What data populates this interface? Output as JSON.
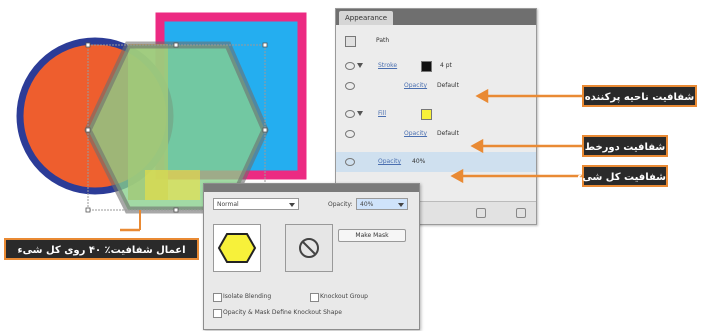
{
  "colors": {
    "accent_orange": "#e98a34",
    "callout_bg": "#2a2a2a",
    "circle_fill": "#ee5e2e",
    "circle_stroke": "#2c3c97",
    "rect_fill": "#24aef0",
    "rect_stroke": "#ec2a82",
    "hexagon_fill": "#88cf8c",
    "hexagon_stroke": "#6e6e6e",
    "highlight_yellow": "#f7e43a"
  },
  "appearance_panel": {
    "tab_label": "Appearance",
    "rows": [
      {
        "label": "Path",
        "icon": "path-swatch-icon"
      },
      {
        "label": "Stroke",
        "value": "4 pt"
      },
      {
        "label": "Opacity",
        "value": "Default"
      },
      {
        "label": "Fill"
      },
      {
        "label": "Opacity",
        "value": "Default"
      },
      {
        "label": "Opacity",
        "value": "40%"
      }
    ]
  },
  "transparency_panel": {
    "blend_mode": "Normal",
    "opacity_label": "Opacity:",
    "opacity_value": "40%",
    "make_mask_label": "Make Mask",
    "options": [
      {
        "label": "Isolate Blending",
        "checked": false
      },
      {
        "label": "Knockout Group",
        "checked": false
      },
      {
        "label": "Opacity & Mask Define Knockout Shape",
        "checked": false
      }
    ]
  },
  "callouts": {
    "fill_opacity": "شفافیت ناحیه پرکننده",
    "stroke_opacity": "شفافیت دورخط",
    "object_opacity": "شفافیت کل شیء",
    "apply_40": "اعمال شفافیت٪ ۴۰ روی کل شیء"
  }
}
